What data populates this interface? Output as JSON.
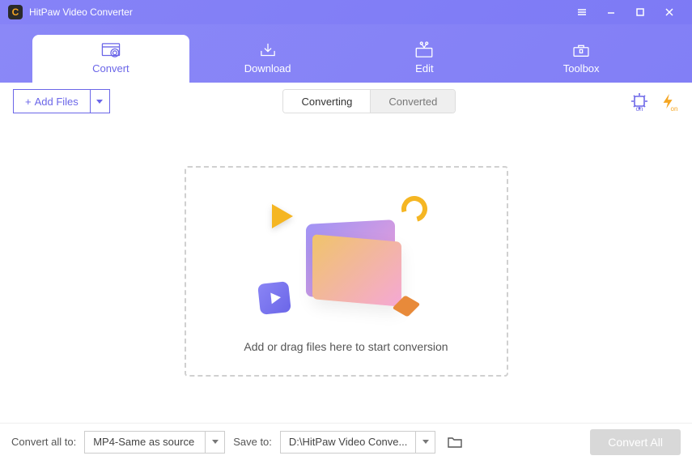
{
  "app": {
    "title": "HitPaw Video Converter"
  },
  "tabs": {
    "convert": "Convert",
    "download": "Download",
    "edit": "Edit",
    "toolbox": "Toolbox"
  },
  "toolbar": {
    "add_files": "Add Files",
    "segment_converting": "Converting",
    "segment_converted": "Converted",
    "gpu_badge": "on",
    "lightning_badge": "on"
  },
  "dropzone": {
    "text": "Add or drag files here to start conversion"
  },
  "footer": {
    "convert_all_to_label": "Convert all to:",
    "format_value": "MP4-Same as source",
    "save_to_label": "Save to:",
    "save_path": "D:\\HitPaw Video Conve...",
    "convert_all_btn": "Convert All"
  }
}
